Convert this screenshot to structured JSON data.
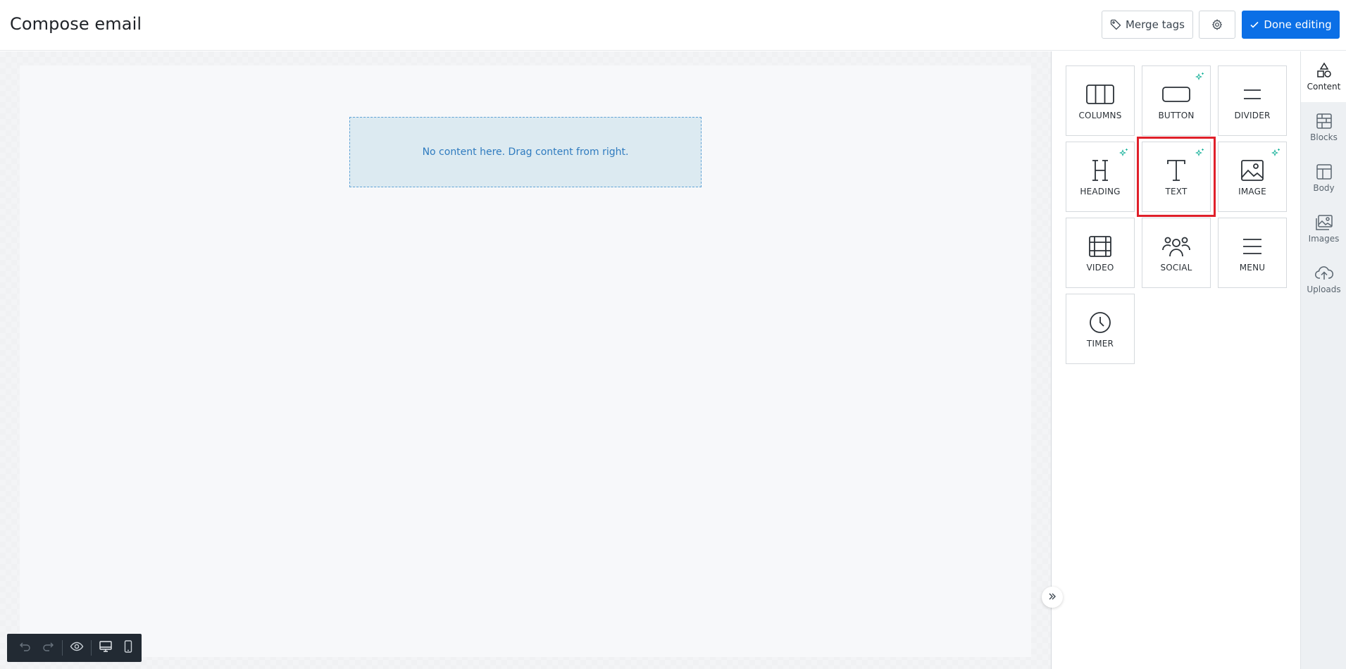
{
  "header": {
    "title": "Compose email",
    "merge_tags_label": "Merge tags",
    "done_label": "Done editing"
  },
  "canvas": {
    "empty_message": "No content here. Drag content from right."
  },
  "content_tiles": [
    {
      "label": "COLUMNS",
      "icon": "columns-icon",
      "ai": false
    },
    {
      "label": "BUTTON",
      "icon": "button-icon",
      "ai": true
    },
    {
      "label": "DIVIDER",
      "icon": "divider-icon",
      "ai": false
    },
    {
      "label": "HEADING",
      "icon": "heading-icon",
      "ai": true
    },
    {
      "label": "TEXT",
      "icon": "text-icon",
      "ai": true,
      "selected": true
    },
    {
      "label": "IMAGE",
      "icon": "image-icon",
      "ai": true
    },
    {
      "label": "VIDEO",
      "icon": "video-icon",
      "ai": false
    },
    {
      "label": "SOCIAL",
      "icon": "social-icon",
      "ai": false
    },
    {
      "label": "MENU",
      "icon": "menu-icon",
      "ai": false
    },
    {
      "label": "TIMER",
      "icon": "timer-icon",
      "ai": false
    }
  ],
  "rail": [
    {
      "label": "Content",
      "icon": "shapes-icon",
      "active": true
    },
    {
      "label": "Blocks",
      "icon": "blocks-icon",
      "active": false
    },
    {
      "label": "Body",
      "icon": "layout-icon",
      "active": false
    },
    {
      "label": "Images",
      "icon": "images-icon",
      "active": false
    },
    {
      "label": "Uploads",
      "icon": "cloud-upload-icon",
      "active": false
    }
  ],
  "colors": {
    "accent": "#0b6fe6",
    "ai_sparkle": "#2bb8a3",
    "selection": "#e0202a",
    "drop_zone": "#dceaf1"
  }
}
